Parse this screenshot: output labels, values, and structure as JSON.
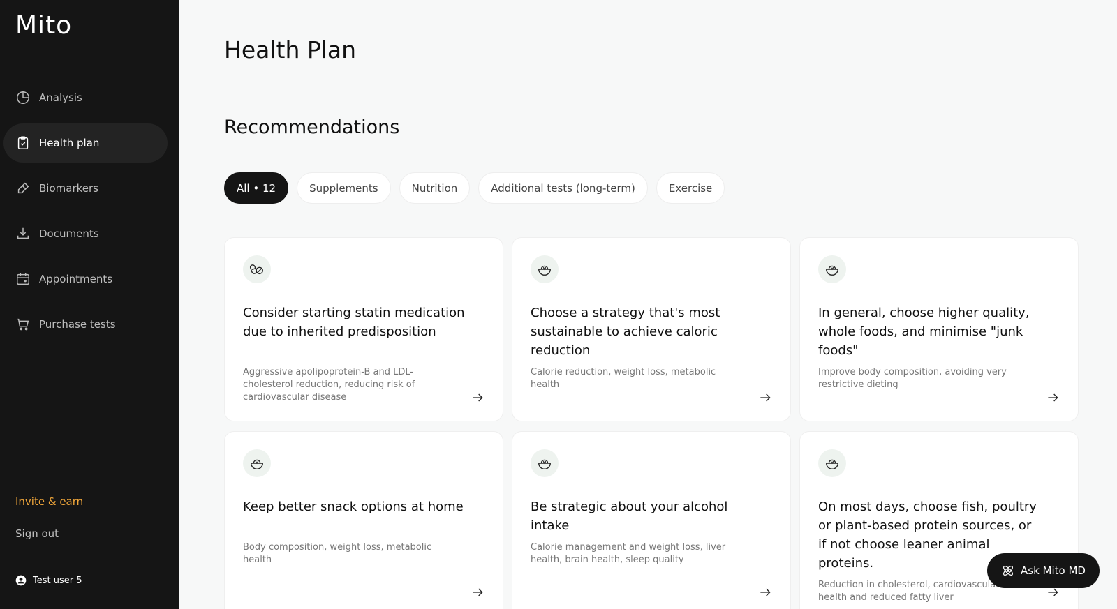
{
  "app": {
    "logo": "Mito"
  },
  "sidebar": {
    "items": [
      {
        "label": "Analysis",
        "icon": "pie-chart-icon"
      },
      {
        "label": "Health plan",
        "icon": "clipboard-check-icon",
        "active": true
      },
      {
        "label": "Biomarkers",
        "icon": "eraser-icon"
      },
      {
        "label": "Documents",
        "icon": "download-icon"
      },
      {
        "label": "Appointments",
        "icon": "calendar-icon"
      },
      {
        "label": "Purchase tests",
        "icon": "cart-icon"
      }
    ],
    "invite_label": "Invite & earn",
    "signout_label": "Sign out",
    "user_name": "Test user 5"
  },
  "main": {
    "title": "Health Plan",
    "section_title": "Recommendations",
    "filters": [
      {
        "label": "All • 12",
        "active": true
      },
      {
        "label": "Supplements"
      },
      {
        "label": "Nutrition"
      },
      {
        "label": "Additional tests (long-term)"
      },
      {
        "label": "Exercise"
      }
    ],
    "cards": [
      {
        "icon": "pills-icon",
        "title": "Consider starting statin medication due to inherited predisposition",
        "description": "Aggressive apolipoprotein-B and LDL-cholesterol reduction, reducing risk of cardiovascular disease"
      },
      {
        "icon": "salad-bowl-icon",
        "title": "Choose a strategy that's most sustainable to achieve caloric reduction",
        "description": "Calorie reduction, weight loss, metabolic health"
      },
      {
        "icon": "salad-bowl-icon",
        "title": "In general, choose higher quality, whole foods, and minimise \"junk foods\"",
        "description": "Improve body composition, avoiding very restrictive dieting"
      },
      {
        "icon": "salad-bowl-icon",
        "title": "Keep better snack options at home",
        "description": "Body composition, weight loss, metabolic health"
      },
      {
        "icon": "salad-bowl-icon",
        "title": "Be strategic about your alcohol intake",
        "description": "Calorie management and weight loss, liver health, brain health, sleep quality"
      },
      {
        "icon": "salad-bowl-icon",
        "title": "On most days, choose fish, poultry or plant-based protein sources, or if not choose leaner animal proteins.",
        "description": "Reduction in cholesterol, cardiovascular health and reduced fatty liver"
      }
    ]
  },
  "ask_button": {
    "label": "Ask Mito MD",
    "icon": "atom-icon"
  },
  "colors": {
    "sidebar_bg": "#151515",
    "accent": "#f0a63a",
    "page_bg": "#f7f8f8"
  }
}
